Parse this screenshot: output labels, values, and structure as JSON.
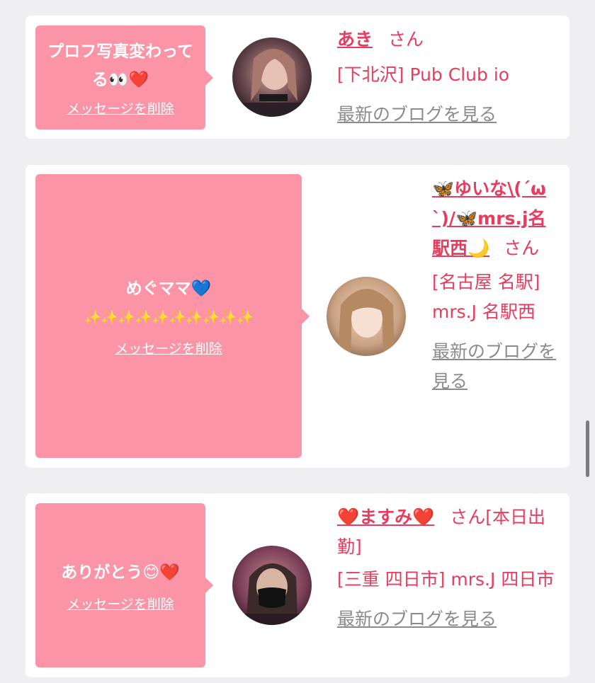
{
  "colors": {
    "accent": "#e83c5e",
    "bubble": "#fb94a6",
    "link_gray": "#8b8b8b",
    "page_bg": "#efeff1"
  },
  "delete_label": "メッセージを削除",
  "honorific": "さん",
  "blog_link": "最新のブログを見る",
  "messages": [
    {
      "text": "プロフ写真変わってる👀❤️",
      "name": "あき",
      "shop": "[下北沢] Pub Club io",
      "avatar_icon": "profile-photo"
    },
    {
      "text_line1": "めぐママ💙",
      "text_line2": "✨✨✨✨✨✨✨✨✨✨",
      "name": "🦋ゆいな\\(´ω`)/🦋mrs.j名駅西🌙",
      "shop": "[名古屋 名駅] mrs.J 名駅西",
      "avatar_icon": "profile-photo"
    },
    {
      "text": "ありがとう😊❤️",
      "name": "❤️ますみ❤️",
      "honorific_extra": "さん[本日出勤]",
      "shop": "[三重 四日市] mrs.J 四日市",
      "avatar_icon": "profile-photo"
    }
  ]
}
